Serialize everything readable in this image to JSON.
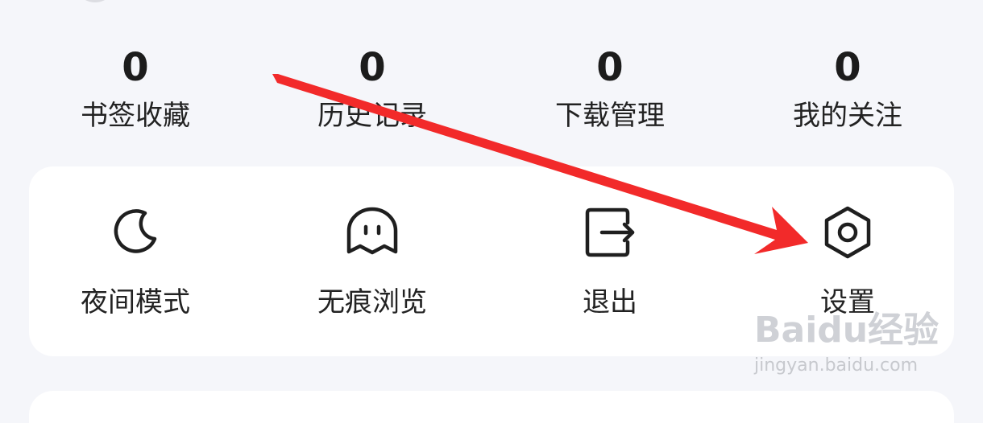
{
  "stats": [
    {
      "value": "0",
      "label": "书签收藏",
      "icon": ""
    },
    {
      "value": "0",
      "label": "历史记录",
      "icon": ""
    },
    {
      "value": "0",
      "label": "下载管理",
      "icon": ""
    },
    {
      "value": "0",
      "label": "我的关注",
      "icon": ""
    }
  ],
  "tools": [
    {
      "label": "夜间模式",
      "icon": "moon-icon"
    },
    {
      "label": "无痕浏览",
      "icon": "ghost-icon"
    },
    {
      "label": "退出",
      "icon": "exit-icon"
    },
    {
      "label": "设置",
      "icon": "settings-icon"
    }
  ],
  "annotation": {
    "color": "#f22a2a"
  },
  "watermark": {
    "brand": "Baidu经验",
    "url": "jingyan.baidu.com"
  }
}
